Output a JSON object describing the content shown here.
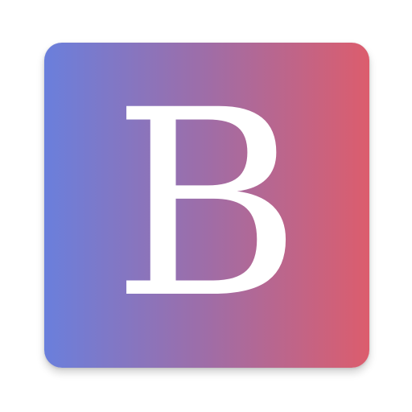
{
  "icon": {
    "letter": "B",
    "letter_color": "#ffffff",
    "gradient_colors": [
      "#6a7fdc",
      "#9f6da7",
      "#dc5d6d"
    ]
  }
}
